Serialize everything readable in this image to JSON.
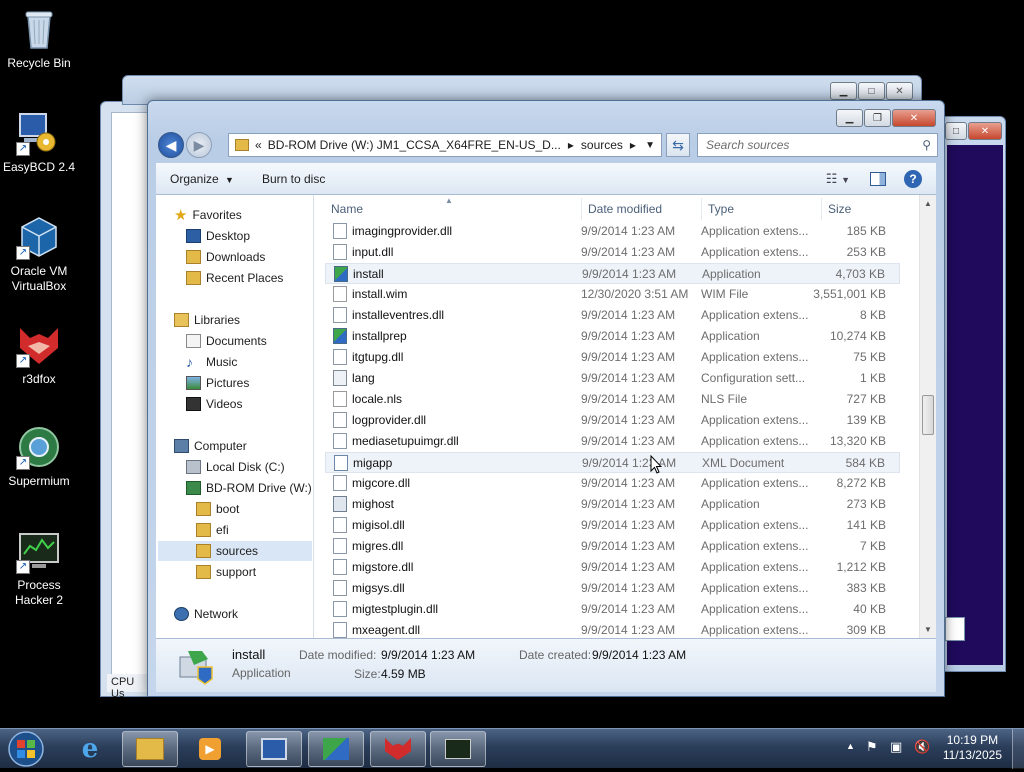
{
  "desktop": {
    "icons": [
      {
        "label": "Recycle Bin"
      },
      {
        "label": "EasyBCD 2.4"
      },
      {
        "label": "Oracle VM VirtualBox"
      },
      {
        "label": "r3dfox"
      },
      {
        "label": "Supermium"
      },
      {
        "label": "Process Hacker 2"
      }
    ]
  },
  "background_window": {
    "status_text": "CPU Us"
  },
  "explorer": {
    "address": {
      "chevron": "«",
      "crumbs": [
        "BD-ROM Drive (W:) JM1_CCSA_X64FRE_EN-US_D...",
        "sources"
      ]
    },
    "search": {
      "placeholder": "Search sources"
    },
    "toolbar": {
      "organize": "Organize",
      "burn": "Burn to disc"
    },
    "nav": {
      "favorites": "Favorites",
      "desktop": "Desktop",
      "downloads": "Downloads",
      "recent": "Recent Places",
      "libraries": "Libraries",
      "documents": "Documents",
      "music": "Music",
      "pictures": "Pictures",
      "videos": "Videos",
      "computer": "Computer",
      "local_disk": "Local Disk (C:)",
      "bdrom": "BD-ROM Drive (W:) .",
      "boot": "boot",
      "efi": "efi",
      "sources": "sources",
      "support": "support",
      "network": "Network"
    },
    "columns": {
      "name": "Name",
      "date": "Date modified",
      "type": "Type",
      "size": "Size"
    },
    "files": [
      {
        "name": "imagingprovider.dll",
        "date": "9/9/2014 1:23 AM",
        "type": "Application extens...",
        "size": "185 KB",
        "icon": "dll-icon"
      },
      {
        "name": "input.dll",
        "date": "9/9/2014 1:23 AM",
        "type": "Application extens...",
        "size": "253 KB",
        "icon": "dll-icon"
      },
      {
        "name": "install",
        "date": "9/9/2014 1:23 AM",
        "type": "Application",
        "size": "4,703 KB",
        "icon": "setup-icon"
      },
      {
        "name": "install.wim",
        "date": "12/30/2020 3:51 AM",
        "type": "WIM File",
        "size": "3,551,001 KB",
        "icon": "file-icon"
      },
      {
        "name": "installeventres.dll",
        "date": "9/9/2014 1:23 AM",
        "type": "Application extens...",
        "size": "8 KB",
        "icon": "dll-icon"
      },
      {
        "name": "installprep",
        "date": "9/9/2014 1:23 AM",
        "type": "Application",
        "size": "10,274 KB",
        "icon": "setup-icon"
      },
      {
        "name": "itgtupg.dll",
        "date": "9/9/2014 1:23 AM",
        "type": "Application extens...",
        "size": "75 KB",
        "icon": "dll-icon"
      },
      {
        "name": "lang",
        "date": "9/9/2014 1:23 AM",
        "type": "Configuration sett...",
        "size": "1 KB",
        "icon": "config-icon"
      },
      {
        "name": "locale.nls",
        "date": "9/9/2014 1:23 AM",
        "type": "NLS File",
        "size": "727 KB",
        "icon": "file-icon"
      },
      {
        "name": "logprovider.dll",
        "date": "9/9/2014 1:23 AM",
        "type": "Application extens...",
        "size": "139 KB",
        "icon": "dll-icon"
      },
      {
        "name": "mediasetupuimgr.dll",
        "date": "9/9/2014 1:23 AM",
        "type": "Application extens...",
        "size": "13,320 KB",
        "icon": "dll-icon"
      },
      {
        "name": "migapp",
        "date": "9/9/2014 1:23 AM",
        "type": "XML Document",
        "size": "584 KB",
        "icon": "xml-icon"
      },
      {
        "name": "migcore.dll",
        "date": "9/9/2014 1:23 AM",
        "type": "Application extens...",
        "size": "8,272 KB",
        "icon": "dll-icon"
      },
      {
        "name": "mighost",
        "date": "9/9/2014 1:23 AM",
        "type": "Application",
        "size": "273 KB",
        "icon": "exe-icon"
      },
      {
        "name": "migisol.dll",
        "date": "9/9/2014 1:23 AM",
        "type": "Application extens...",
        "size": "141 KB",
        "icon": "dll-icon"
      },
      {
        "name": "migres.dll",
        "date": "9/9/2014 1:23 AM",
        "type": "Application extens...",
        "size": "7 KB",
        "icon": "dll-icon"
      },
      {
        "name": "migstore.dll",
        "date": "9/9/2014 1:23 AM",
        "type": "Application extens...",
        "size": "1,212 KB",
        "icon": "dll-icon"
      },
      {
        "name": "migsys.dll",
        "date": "9/9/2014 1:23 AM",
        "type": "Application extens...",
        "size": "383 KB",
        "icon": "dll-icon"
      },
      {
        "name": "migtestplugin.dll",
        "date": "9/9/2014 1:23 AM",
        "type": "Application extens...",
        "size": "40 KB",
        "icon": "dll-icon"
      },
      {
        "name": "mxeagent.dll",
        "date": "9/9/2014 1:23 AM",
        "type": "Application extens...",
        "size": "309 KB",
        "icon": "dll-icon"
      }
    ],
    "details": {
      "name": "install",
      "type": "Application",
      "date_modified_label": "Date modified:",
      "date_modified": "9/9/2014 1:23 AM",
      "date_created_label": "Date created:",
      "date_created": "9/9/2014 1:23 AM",
      "size_label": "Size:",
      "size": "4.59 MB"
    }
  },
  "taskbar": {
    "time": "10:19 PM",
    "date": "11/13/2025"
  },
  "colors": {
    "desktop_bg": "#000000",
    "titlebar": "#c9d9ee",
    "taskbar": "#2b3e5a",
    "selection": "#d9e6f5"
  }
}
